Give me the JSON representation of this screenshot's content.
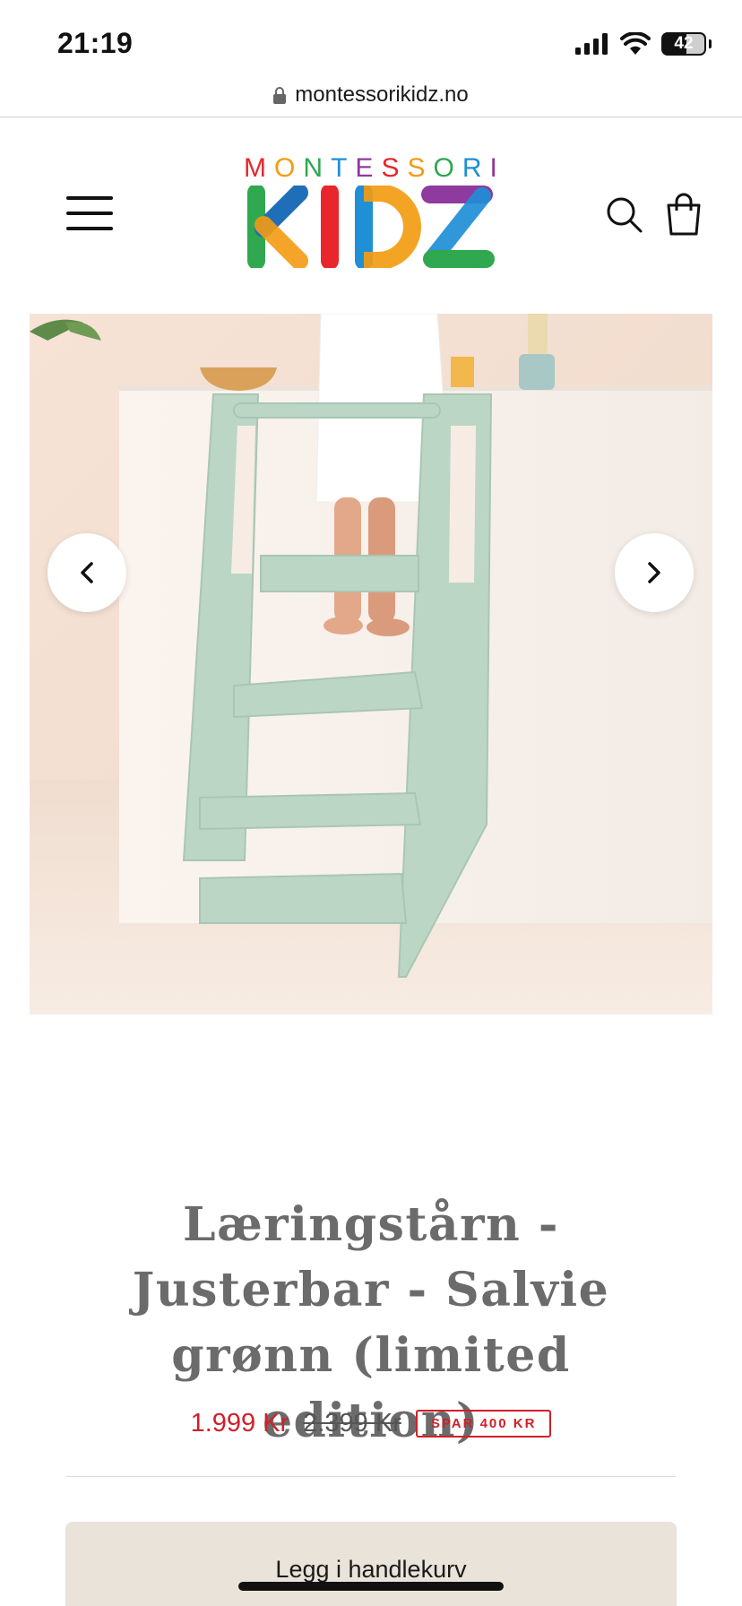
{
  "status_bar": {
    "time": "21:19",
    "battery": "42",
    "icons": [
      "signal-icon",
      "wifi-icon",
      "battery-icon"
    ]
  },
  "browser": {
    "url": "montessorikidz.no",
    "lock_icon": "lock-icon"
  },
  "header": {
    "logo_top": "MONTESSORI",
    "logo_bottom": "KIDZ",
    "menu_icon": "hamburger-menu-icon",
    "search_icon": "search-icon",
    "cart_icon": "shopping-bag-icon",
    "logo_colors": [
      "#e8262b",
      "#f39c12",
      "#2fa84f",
      "#1f8fd6",
      "#8e3a9e"
    ]
  },
  "gallery": {
    "prev_icon": "chevron-left-icon",
    "next_icon": "chevron-right-icon"
  },
  "product": {
    "title": "Læringstårn - Justerbar - Salvie grønn (limited edition)",
    "price": "1.999 Kr",
    "compare_price": "2.399 Kr",
    "save_badge": "SPAR 400 KR",
    "add_to_cart_label": "Legg i handlekurv"
  },
  "colors": {
    "sale_red": "#d0202a",
    "button_bg": "#e9e3d9",
    "title_gray": "#6b6b6b",
    "tower_sage": "#b9d4c4"
  }
}
